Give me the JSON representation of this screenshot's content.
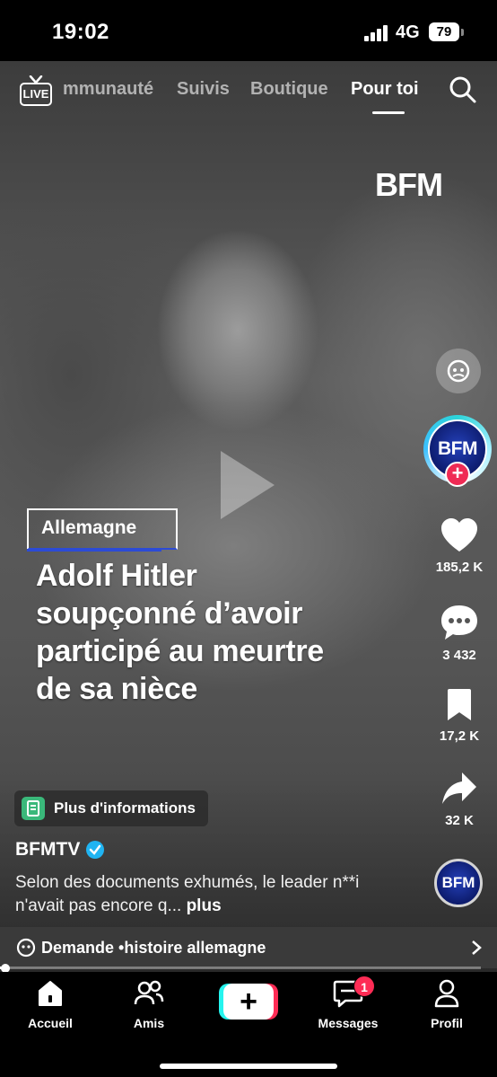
{
  "status_bar": {
    "time": "19:02",
    "network": "4G",
    "battery": "79"
  },
  "top_nav": {
    "live_label": "LIVE",
    "tabs": [
      {
        "label": "mmunauté",
        "active": false
      },
      {
        "label": "Suivis",
        "active": false
      },
      {
        "label": "Boutique",
        "active": false
      },
      {
        "label": "Pour toi",
        "active": true
      }
    ]
  },
  "video": {
    "watermark": "BFM",
    "tag": "Allemagne",
    "headline_lines": [
      "Adolf Hitler",
      "soupçonné d’avoir",
      "participé au meurtre",
      "de sa nièce"
    ]
  },
  "creator": {
    "avatar_text": "BFM",
    "name": "BFMTV",
    "verified": true
  },
  "actions": {
    "likes": "185,2 K",
    "comments": "3 432",
    "saves": "17,2 K",
    "shares": "32 K"
  },
  "more_info_label": "Plus d'informations",
  "description": {
    "text": "Selon des documents exhumés, le leader n**i n'avait pas encore q...",
    "more": "plus"
  },
  "sound_avatar_text": "BFM",
  "search_suggestion": {
    "prefix": "Demande • ",
    "query": "histoire allemagne"
  },
  "progress": {
    "fraction": 0.01
  },
  "bottom_nav": {
    "home": "Accueil",
    "friends": "Amis",
    "inbox": "Messages",
    "inbox_badge": "1",
    "profile": "Profil"
  },
  "colors": {
    "accent_red": "#fe2c55",
    "accent_cyan": "#25f4ee",
    "bfm_blue": "#0d1c6e",
    "verified_blue": "#20b4f2"
  }
}
